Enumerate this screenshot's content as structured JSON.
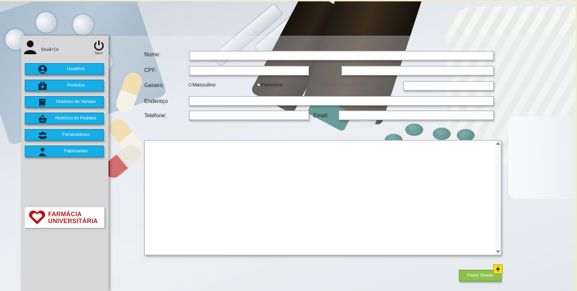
{
  "sidebar": {
    "user_label": "Usuário",
    "logout_label": "Sair",
    "items": [
      {
        "label": "Usuários",
        "icon": "user-circle-icon"
      },
      {
        "label": "Produtos",
        "icon": "medkit-icon"
      },
      {
        "label": "Histórico de Vendas",
        "icon": "book-icon"
      },
      {
        "label": "Histórico de Pedidos",
        "icon": "shopping-basket-icon"
      },
      {
        "label": "Fornecedores",
        "icon": "users-group-icon"
      },
      {
        "label": "Fabricantes",
        "icon": "doctor-icon"
      }
    ],
    "logo": {
      "line1": "FARMÁCIA",
      "line2": "UNIVERSITÁRIA",
      "color": "#b3161c"
    }
  },
  "form": {
    "nome_label": "Nome:",
    "nome_value": "",
    "cpf_label": "CPF:",
    "cpf_value": "",
    "rg_value": "",
    "genero_label": "Genero:",
    "genero_options": [
      "Masculino",
      "Feminino"
    ],
    "nascimento_label": "Data de Nascimento",
    "nascimento_value": "",
    "endereco_label": "Endereço",
    "endereco_value": "",
    "telefone_label": "Telefone:",
    "telefone_value": "",
    "email_label": "Email:",
    "email_value": "",
    "notes_value": ""
  },
  "actions": {
    "sell_label": "Fazer Venda"
  },
  "colors": {
    "nav": "#16aee9",
    "sell": "#8bc34a",
    "bolt": "#f5df18",
    "sidebar": "#d7d7d7"
  }
}
